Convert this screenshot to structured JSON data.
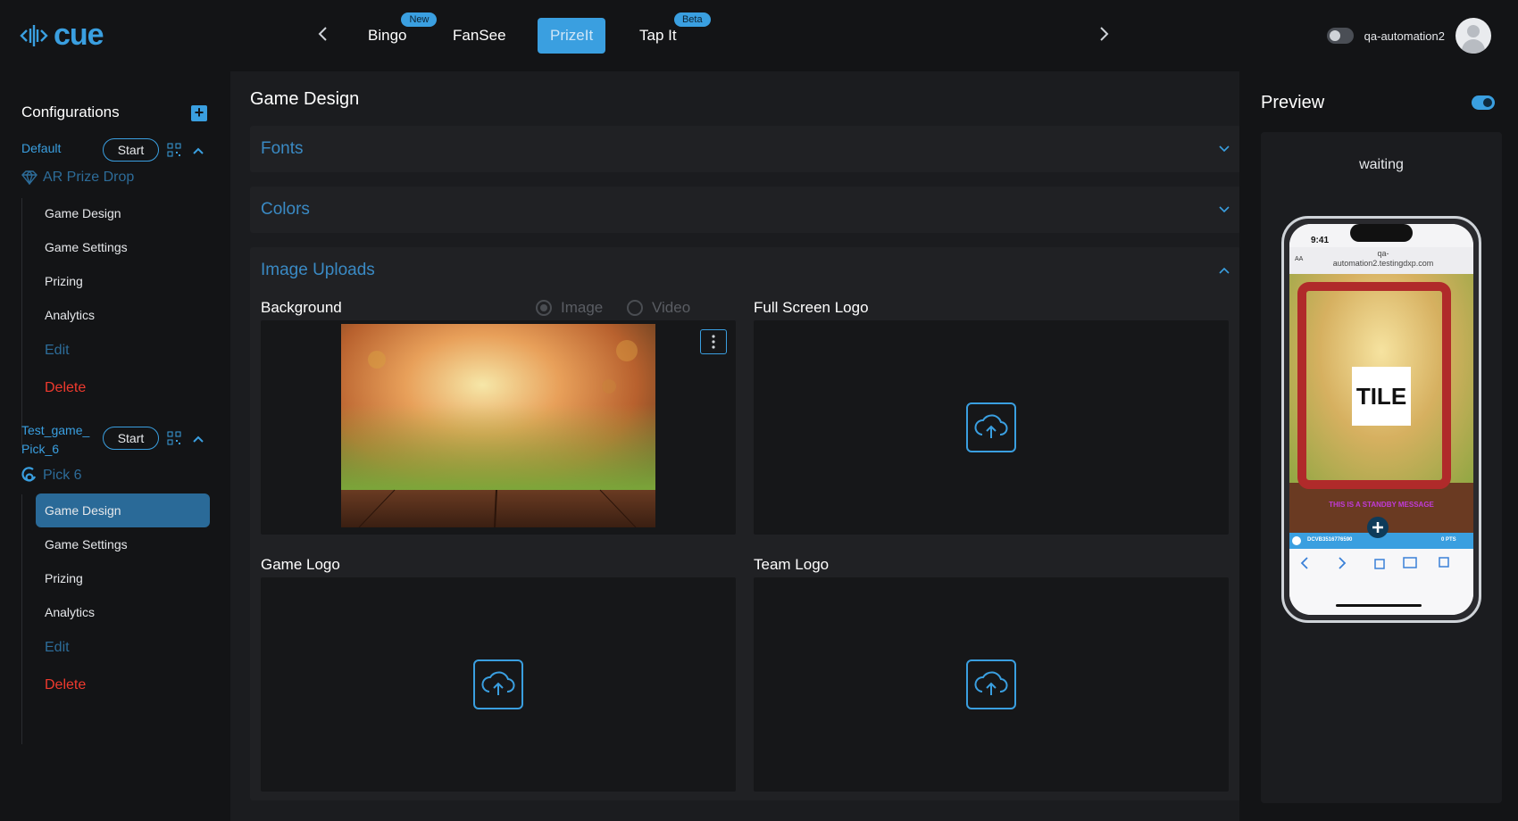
{
  "app": {
    "logo_text": "cue"
  },
  "topnav": {
    "tabs": [
      {
        "label": "Bingo",
        "badge": "New"
      },
      {
        "label": "FanSee",
        "badge": ""
      },
      {
        "label": "PrizeIt",
        "badge": ""
      },
      {
        "label": "Tap It",
        "badge": "Beta"
      }
    ],
    "active_tab": "PrizeIt"
  },
  "user": {
    "name": "qa-automation2"
  },
  "sidebar": {
    "title": "Configurations",
    "configs": [
      {
        "name": "Default",
        "start_label": "Start",
        "game_type": "AR Prize Drop",
        "items": [
          "Game Design",
          "Game Settings",
          "Prizing",
          "Analytics"
        ],
        "edit_label": "Edit",
        "delete_label": "Delete"
      },
      {
        "name_line1": "Test_game_",
        "name_line2": "Pick_6",
        "start_label": "Start",
        "game_type": "Pick 6",
        "items": [
          "Game Design",
          "Game Settings",
          "Prizing",
          "Analytics"
        ],
        "edit_label": "Edit",
        "delete_label": "Delete"
      }
    ]
  },
  "main": {
    "title": "Game Design",
    "sections": {
      "fonts": "Fonts",
      "colors": "Colors",
      "image_uploads": "Image Uploads"
    },
    "uploads": {
      "background": "Background",
      "radio_image": "Image",
      "radio_video": "Video",
      "full_screen_logo": "Full Screen Logo",
      "game_logo": "Game Logo",
      "team_logo": "Team Logo"
    }
  },
  "preview": {
    "title": "Preview",
    "status": "waiting",
    "phone": {
      "time": "9:41",
      "aa": "AA",
      "url_line1": "qa-",
      "url_line2": "automation2.testingdxp.com",
      "tile_text": "TILE",
      "standby_message": "THIS IS A STANDBY MESSAGE",
      "device_id": "DCVB3516776590",
      "points": "0 PTS"
    }
  },
  "colors": {
    "accent": "#3a9fe0",
    "danger": "#ef3a2e",
    "bg": "#131416",
    "panel": "#1b1c1f"
  }
}
